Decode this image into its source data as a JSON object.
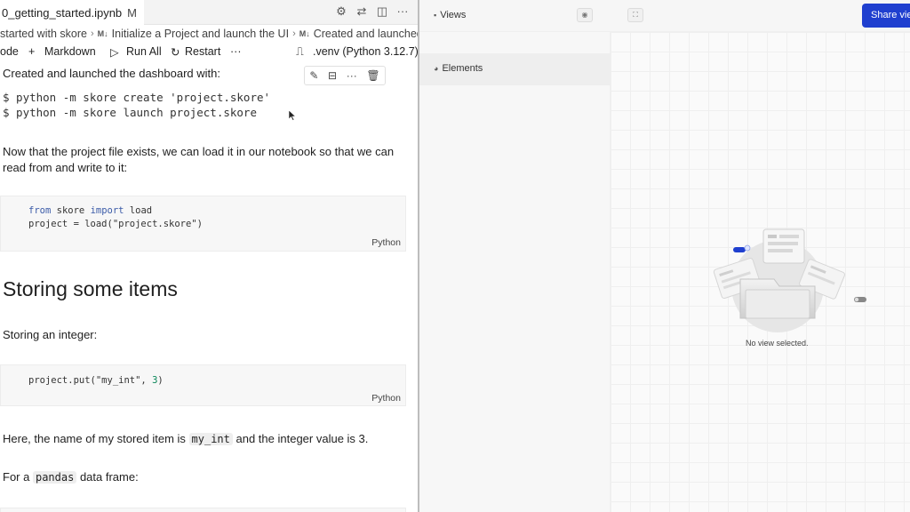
{
  "notebook": {
    "tab": {
      "filename": "0_getting_started.ipynb",
      "modified": "M"
    },
    "breadcrumbs": [
      "started with skore",
      "Initialize a Project and launch the UI",
      "Created and launched the"
    ],
    "toolbar": {
      "code_label": "ode",
      "markdown_label": "Markdown",
      "run_all_label": "Run All",
      "restart_label": "Restart",
      "more": "···",
      "kernel_label": ".venv (Python 3.12.7)"
    },
    "cells": {
      "intro": "Created and launched the dashboard with:",
      "shell_line1": "$ python -m skore create 'project.skore'",
      "shell_line2": "$ python -m skore launch project.skore",
      "load_text": "Now that the project file exists, we can load it in our notebook so that we can read from and write to it:",
      "code1_from": "from",
      "code1_module": " skore ",
      "code1_import": "import",
      "code1_name": " load",
      "code1_line2": "project = load(\"project.skore\")",
      "code_lang": "Python",
      "heading": "Storing some items",
      "int_text": "Storing an integer:",
      "code2_pre": "project.put(\"my_int\", ",
      "code2_num": "3",
      "code2_post": ")",
      "desc_pre": "Here, the name of my stored item is ",
      "desc_code": "my_int",
      "desc_post": " and the integer value is 3.",
      "df_pre": "For a ",
      "df_code": "pandas",
      "df_post": " data frame:"
    }
  },
  "app": {
    "views_label": "Views",
    "share_label": "Share vie",
    "elements_label": "Elements",
    "empty_state": "No view selected.",
    "accent_color": "#1f3fcf"
  }
}
